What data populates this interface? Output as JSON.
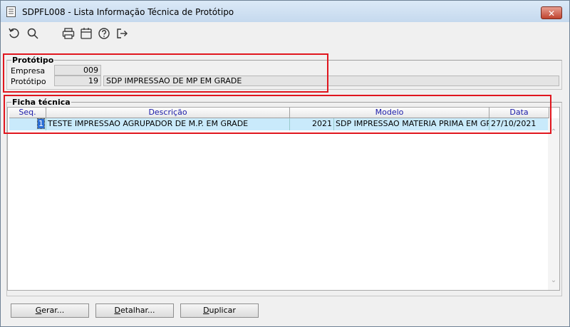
{
  "window": {
    "title": "SDPFL008 - Lista Informação Técnica de Protótipo",
    "close_label": "✕"
  },
  "toolbar": {
    "icons": [
      "refresh-icon",
      "search-icon",
      "print-icon",
      "calendar-icon",
      "help-icon",
      "exit-icon"
    ]
  },
  "prototipo": {
    "legend": "Protótipo",
    "empresa_label": "Empresa",
    "empresa_value": "009",
    "prototipo_label": "Protótipo",
    "prototipo_code": "19",
    "prototipo_desc": "SDP IMPRESSAO DE MP EM GRADE"
  },
  "ficha": {
    "legend": "Ficha técnica",
    "columns": {
      "seq": "Seq.",
      "descricao": "Descrição",
      "modelo": "Modelo",
      "data": "Data"
    },
    "rows": [
      {
        "seq": "1",
        "descricao": "TESTE IMPRESSAO AGRUPADOR DE M.P. EM GRADE",
        "modelo_code": "2021",
        "modelo_desc": "SDP IMPRESSAO MATERIA PRIMA EM GRADE",
        "data": "27/10/2021"
      }
    ]
  },
  "buttons": {
    "gerar_u": "G",
    "gerar_rest": "erar...",
    "detalhar_u": "D",
    "detalhar_rest": "etalhar...",
    "duplicar_u": "D",
    "duplicar_rest": "uplicar"
  },
  "colors": {
    "highlight_row": "#c9eafb",
    "annotation_red": "#e0161e",
    "header_text": "#1a1aa8"
  }
}
